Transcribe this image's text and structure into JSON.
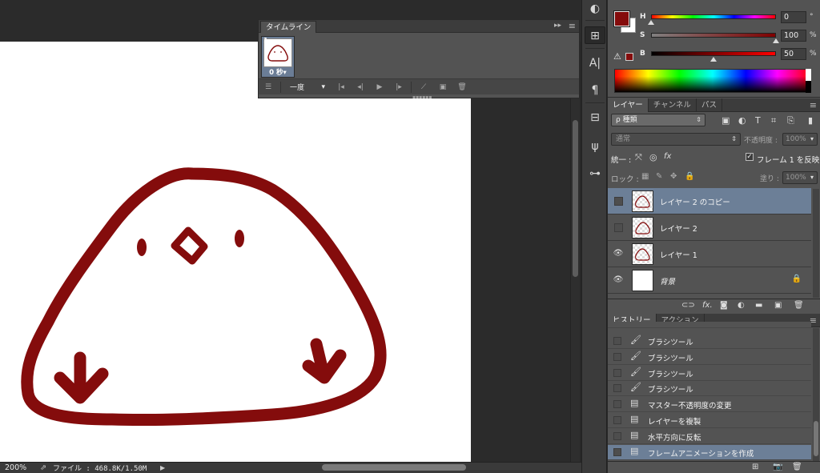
{
  "timeline": {
    "tab_label": "タイムライン",
    "collapse_glyph": "▸▸",
    "frame": {
      "number": "1",
      "delay": "0 秒▾"
    },
    "loop_option": "一度"
  },
  "status": {
    "zoom": "200%",
    "file_info": "ファイル : 468.8K/1.50M"
  },
  "color": {
    "foreground": "#840c0c",
    "background": "#ffffff",
    "h": {
      "label": "H",
      "value": "0",
      "unit": "°",
      "fraction": 0.0
    },
    "s": {
      "label": "S",
      "value": "100",
      "unit": "%",
      "fraction": 1.0
    },
    "b": {
      "label": "B",
      "value": "50",
      "unit": "%",
      "fraction": 0.5
    }
  },
  "layers_panel": {
    "tabs": [
      "レイヤー",
      "チャンネル",
      "パス"
    ],
    "filter_kind": "ρ 種類",
    "blend_mode": "通常",
    "opacity_label": "不透明度 :",
    "opacity_value": "100%",
    "unify_label": "統一 :",
    "propagate_label": "フレーム 1 を反映",
    "lock_label": "ロック :",
    "fill_label": "塗り :",
    "fill_value": "100%",
    "layers": [
      {
        "name": "レイヤー 2 のコピー",
        "visible": false,
        "selected": true
      },
      {
        "name": "レイヤー 2",
        "visible": false,
        "selected": false
      },
      {
        "name": "レイヤー 1",
        "visible": true,
        "selected": false
      },
      {
        "name": "背景",
        "visible": true,
        "selected": false,
        "locked": true
      }
    ]
  },
  "history_panel": {
    "tabs": [
      "ヒストリー",
      "アクション"
    ],
    "items": [
      {
        "name": "ブラシツール",
        "icon": "brush-icon"
      },
      {
        "name": "ブラシツール",
        "icon": "brush-icon"
      },
      {
        "name": "ブラシツール",
        "icon": "brush-icon"
      },
      {
        "name": "ブラシツール",
        "icon": "brush-icon"
      },
      {
        "name": "マスター不透明度の変更",
        "icon": "document-icon"
      },
      {
        "name": "レイヤーを複製",
        "icon": "document-icon"
      },
      {
        "name": "水平方向に反転",
        "icon": "document-icon"
      },
      {
        "name": "フレームアニメーションを作成",
        "icon": "document-icon"
      }
    ]
  }
}
